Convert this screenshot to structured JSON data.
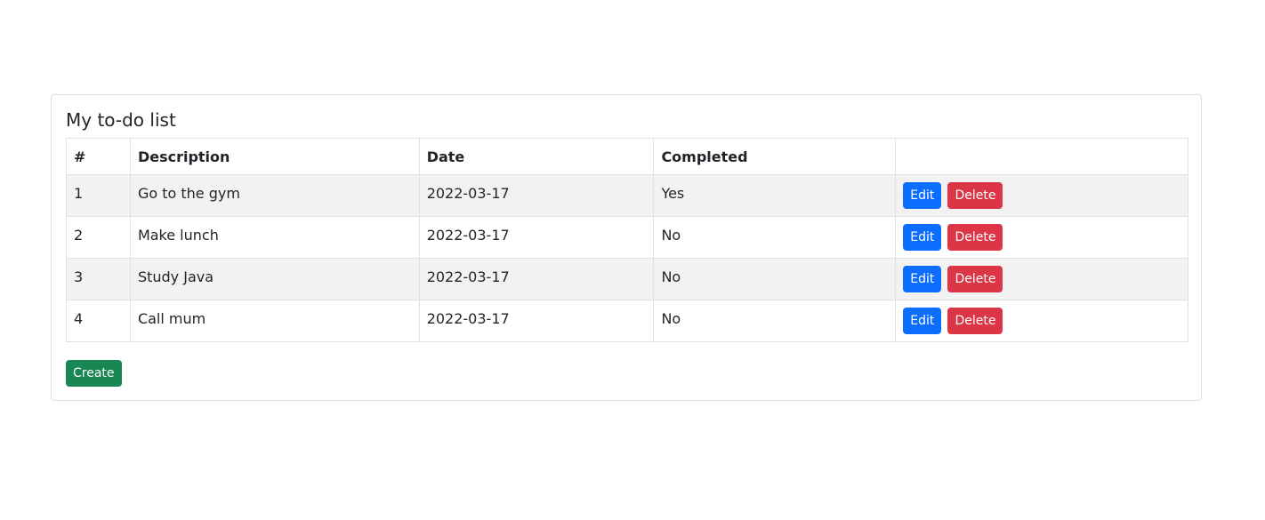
{
  "card": {
    "title": "My to-do list"
  },
  "table": {
    "headers": [
      "#",
      "Description",
      "Date",
      "Completed",
      ""
    ],
    "rows": [
      {
        "id": "1",
        "description": "Go to the gym",
        "date": "2022-03-17",
        "completed": "Yes"
      },
      {
        "id": "2",
        "description": "Make lunch",
        "date": "2022-03-17",
        "completed": "No"
      },
      {
        "id": "3",
        "description": "Study Java",
        "date": "2022-03-17",
        "completed": "No"
      },
      {
        "id": "4",
        "description": "Call mum",
        "date": "2022-03-17",
        "completed": "No"
      }
    ]
  },
  "actions": {
    "edit_label": "Edit",
    "delete_label": "Delete",
    "create_label": "Create"
  },
  "colors": {
    "edit": "#0d6efd",
    "delete": "#dc3545",
    "create": "#198754",
    "stripe": "#f2f2f2"
  }
}
